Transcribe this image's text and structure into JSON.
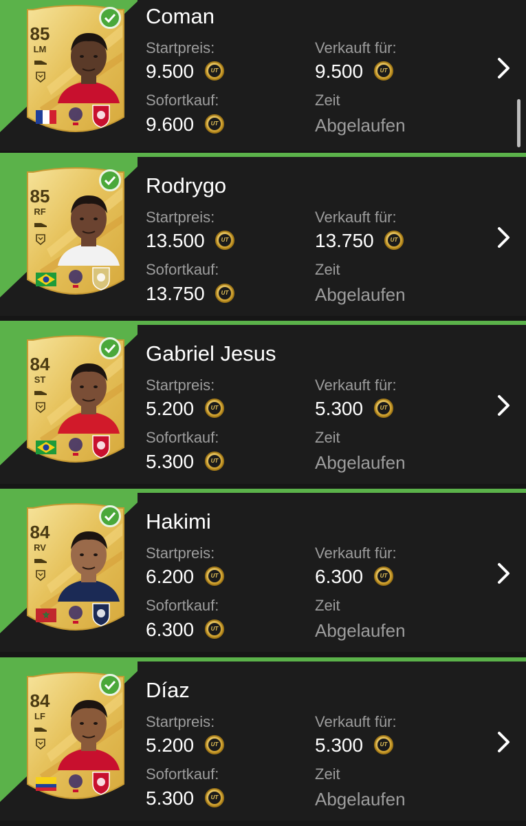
{
  "labels": {
    "start_price": "Startpreis:",
    "sold_for": "Verkauft für:",
    "buy_now": "Sofortkauf:",
    "time": "Zeit",
    "expired": "Abgelaufen",
    "coin_mark": "UT"
  },
  "colors": {
    "accent_green": "#5bb24a",
    "row_bg": "#1c1c1c",
    "page_bg": "#161616",
    "label_gray": "#9d9d9d",
    "card_gold": "#e6c25c"
  },
  "items": [
    {
      "name": "Coman",
      "rating": "85",
      "position": "LM",
      "start_price": "9.500",
      "sold_for": "9.500",
      "buy_now": "9.600",
      "skin": "#5a3a28",
      "shirt": "#c8102e",
      "flag": "france-flag",
      "league": "bundesliga-logo",
      "club": "bayern-badge"
    },
    {
      "name": "Rodrygo",
      "rating": "85",
      "position": "RF",
      "start_price": "13.500",
      "sold_for": "13.750",
      "buy_now": "13.750",
      "skin": "#6b4330",
      "shirt": "#f2f2f2",
      "flag": "brazil-flag",
      "league": "laliga-logo",
      "club": "real-madrid-badge"
    },
    {
      "name": "Gabriel Jesus",
      "rating": "84",
      "position": "ST",
      "start_price": "5.200",
      "sold_for": "5.300",
      "buy_now": "5.300",
      "skin": "#7a4e36",
      "shirt": "#d11a2a",
      "flag": "brazil-flag",
      "league": "premier-league-logo",
      "club": "arsenal-badge"
    },
    {
      "name": "Hakimi",
      "rating": "84",
      "position": "RV",
      "start_price": "6.200",
      "sold_for": "6.300",
      "buy_now": "6.300",
      "skin": "#9a6a4a",
      "shirt": "#1b2a55",
      "flag": "morocco-flag",
      "league": "ligue1-logo",
      "club": "psg-badge"
    },
    {
      "name": "Díaz",
      "rating": "84",
      "position": "LF",
      "start_price": "5.200",
      "sold_for": "5.300",
      "buy_now": "5.300",
      "skin": "#8a5a3a",
      "shirt": "#c8102e",
      "flag": "colombia-flag",
      "league": "premier-league-logo",
      "club": "liverpool-badge"
    }
  ]
}
